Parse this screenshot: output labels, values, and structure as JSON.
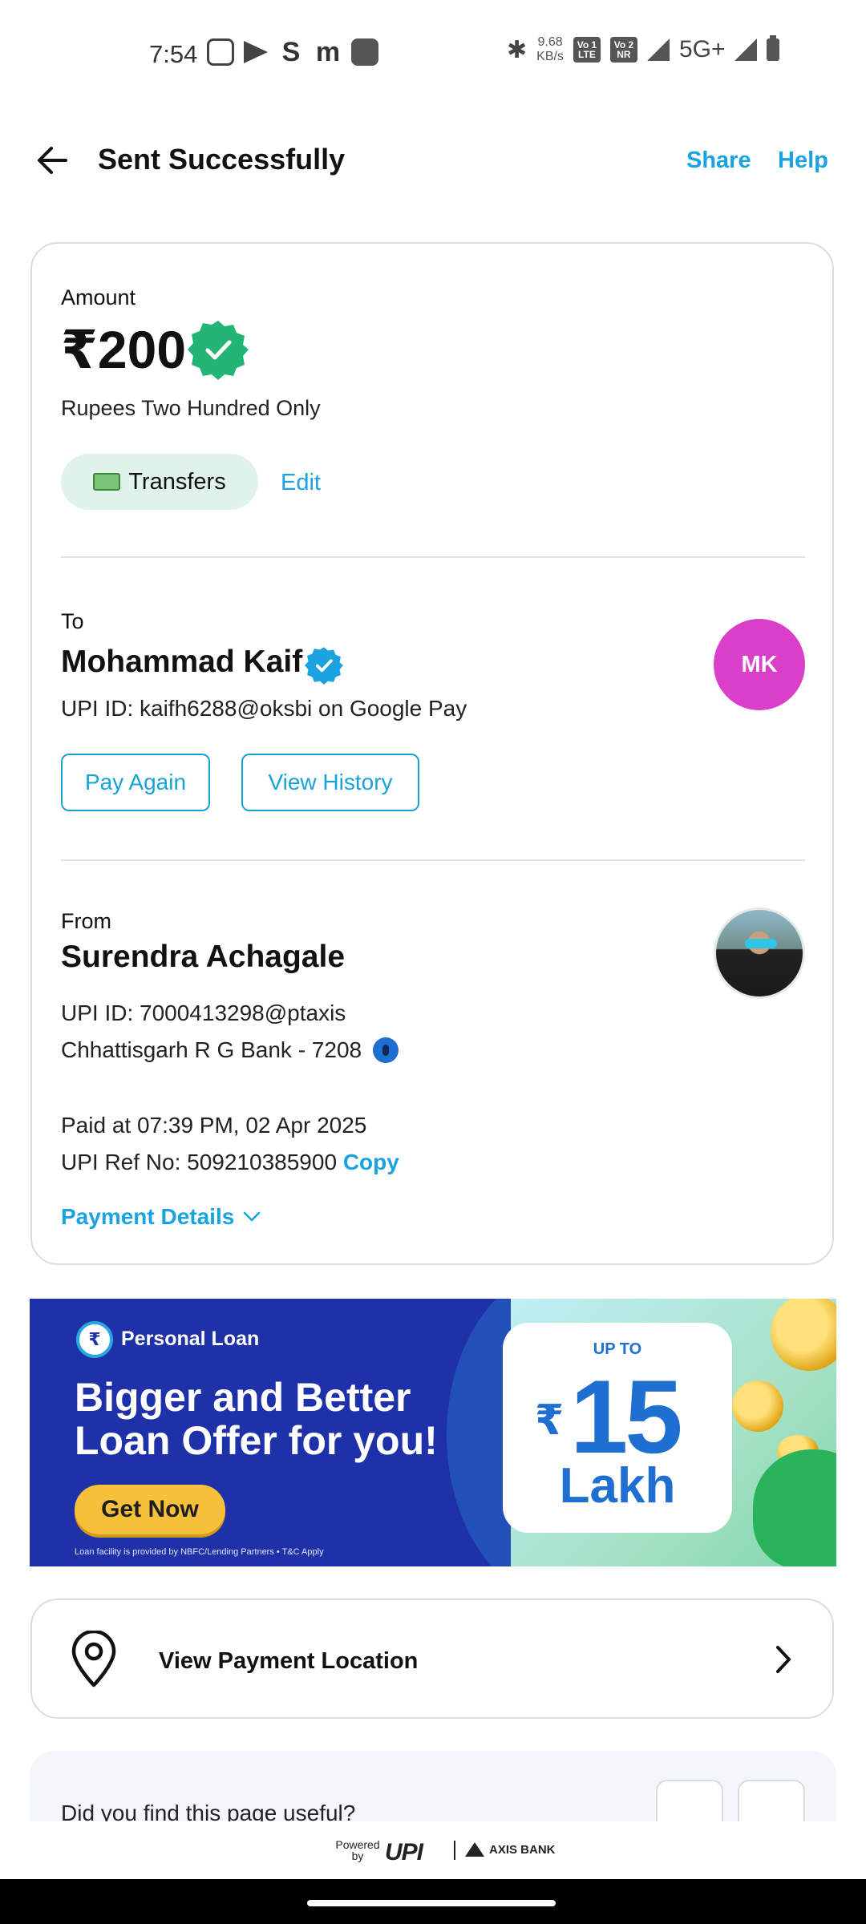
{
  "status_bar": {
    "time": "7:54",
    "speed_value": "9.68",
    "speed_unit": "KB/s",
    "sim1_tag": "Vo 1 LTE",
    "sim2_tag": "Vo 2 NR",
    "network": "5G+"
  },
  "header": {
    "title": "Sent Successfully",
    "share_label": "Share",
    "help_label": "Help"
  },
  "amount_section": {
    "label": "Amount",
    "amount": "₹200",
    "in_words": "Rupees Two Hundred Only",
    "category_chip": "Transfers",
    "edit_label": "Edit"
  },
  "to_section": {
    "label": "To",
    "name": "Mohammad Kaif",
    "upi_line": "UPI ID: kaifh6288@oksbi on Google Pay",
    "avatar_initials": "MK",
    "pay_again_label": "Pay Again",
    "view_history_label": "View History"
  },
  "from_section": {
    "label": "From",
    "name": "Surendra Achagale",
    "upi_line": "UPI ID: 7000413298@ptaxis",
    "bank_line": "Chhattisgarh R G Bank - 7208",
    "paid_at": "Paid at 07:39 PM, 02 Apr 2025",
    "ref_no": "UPI Ref No: 509210385900",
    "copy_label": "Copy",
    "payment_details_label": "Payment Details"
  },
  "banner": {
    "tag": "Personal Loan",
    "headline_line1": "Bigger and Better",
    "headline_line2": "Loan Offer for you!",
    "cta": "Get Now",
    "footnote": "Loan facility is provided by NBFC/Lending Partners • T&C Apply",
    "up_to": "UP TO",
    "rupee_symbol": "₹",
    "amount": "15",
    "unit": "Lakh"
  },
  "location": {
    "label": "View Payment Location"
  },
  "feedback": {
    "question": "Did you find this page useful?"
  },
  "footer": {
    "powered_by": "Powered by",
    "upi": "UPI",
    "bank": "AXIS BANK"
  },
  "colors": {
    "accent": "#1aa3e0",
    "verified_green": "#22b573",
    "avatar_mk": "#d93fc9",
    "banner_blue": "#1e31a8"
  }
}
